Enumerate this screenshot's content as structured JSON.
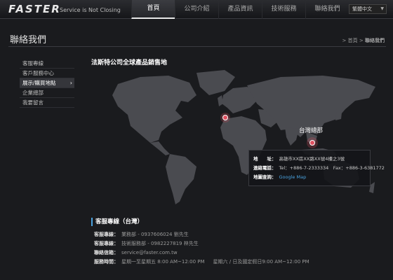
{
  "header": {
    "logo": "FASTER",
    "tagline": "Service is Not Closing",
    "nav": [
      "首頁",
      "公司介紹",
      "產品資訊",
      "技術服務",
      "聯絡我們"
    ],
    "lang": "繁體中文"
  },
  "page": {
    "title": "聯絡我們",
    "breadcrumb_home": "首頁",
    "breadcrumb_sep": ">",
    "breadcrumb_current": "聯絡我們"
  },
  "sidebar": {
    "items": [
      {
        "label": "客服專線"
      },
      {
        "label": "客戶服務中心"
      },
      {
        "label": "展示/購買地點"
      },
      {
        "label": "企業總部"
      },
      {
        "label": "我要留言"
      }
    ],
    "active_index": 2
  },
  "main": {
    "title": "法斯特公司全球產品銷售地",
    "marker_label": "台灣總部",
    "info": {
      "address_label": "地　　址：",
      "address": "高雄市XX區XX路XX號4樓之3號",
      "phone_label": "連絡電話：",
      "phone": "Tel：+886-7-2333334　Fax：+886-3-6381772",
      "map_label": "地圖查詢：",
      "map_link": "Google Map"
    }
  },
  "service": {
    "title": "客服專線（台灣）",
    "rows": [
      {
        "key": "客服專線：",
        "value": "業務部 - 0937606024 劉先生"
      },
      {
        "key": "客服專線：",
        "value": "技術服務部 - 0982227819 林先生"
      },
      {
        "key": "聯絡信箱：",
        "value": "service@faster.com.tw"
      },
      {
        "key": "服務時間：",
        "value": "星期一至星期五 8:00 AM~12:00 PM",
        "value2": "星期六 / 日及國定假日9:00 AM~12:00 PM"
      }
    ]
  },
  "colors": {
    "background": "#1a1b1e",
    "accent": "#4aa3e0",
    "marker": "#e05060"
  }
}
